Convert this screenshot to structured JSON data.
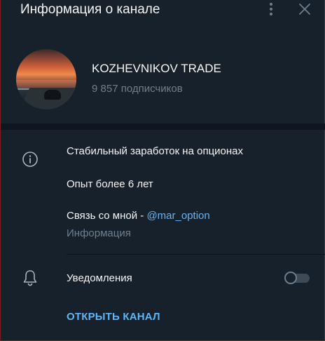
{
  "header": {
    "title": "Информация о канале",
    "menu_icon": "kebab-menu-icon",
    "close_icon": "close-icon"
  },
  "channel": {
    "name": "KOZHEVNIKOV TRADE",
    "subscribers": "9 857 подписчиков"
  },
  "info": {
    "icon": "info-icon",
    "lines": [
      "Стабильный заработок на опционах",
      "Опыт более 6 лет"
    ],
    "contact_prefix": "Связь со мной - ",
    "contact_link": "@mar_option",
    "caption": "Информация"
  },
  "notifications": {
    "icon": "bell-icon",
    "label": "Уведомления",
    "enabled": false
  },
  "actions": {
    "open_channel": "ОТКРЫТЬ КАНАЛ"
  },
  "colors": {
    "background": "#17212b",
    "band": "#0e1621",
    "text": "#f5f5f5",
    "muted": "#6d7f8f",
    "link": "#6ab3f3",
    "accent": "#5eb5f7"
  }
}
